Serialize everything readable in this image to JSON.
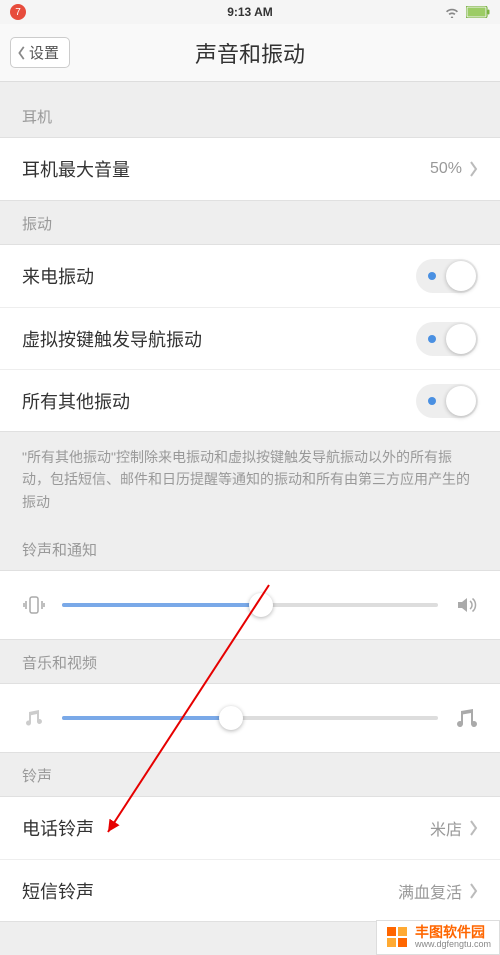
{
  "status": {
    "badge": "7",
    "time": "9:13 AM"
  },
  "nav": {
    "back": "设置",
    "title": "声音和振动"
  },
  "sections": {
    "headphone": {
      "header": "耳机",
      "maxVol": {
        "label": "耳机最大音量",
        "value": "50%"
      }
    },
    "vibrate": {
      "header": "振动",
      "incoming": "来电振动",
      "virtualKey": "虚拟按键触发导航振动",
      "other": "所有其他振动",
      "note": "\"所有其他振动\"控制除来电振动和虚拟按键触发导航振动以外的所有振动，包括短信、邮件和日历提醒等通知的振动和所有由第三方应用产生的振动"
    },
    "ringNotify": {
      "header": "铃声和通知",
      "percent": 53
    },
    "media": {
      "header": "音乐和视频",
      "percent": 45
    },
    "ringtone": {
      "header": "铃声",
      "phone": {
        "label": "电话铃声",
        "value": "米店"
      },
      "sms": {
        "label": "短信铃声",
        "value": "满血复活"
      }
    }
  },
  "watermark": {
    "name": "丰图软件园",
    "url": "www.dgfengtu.com"
  }
}
